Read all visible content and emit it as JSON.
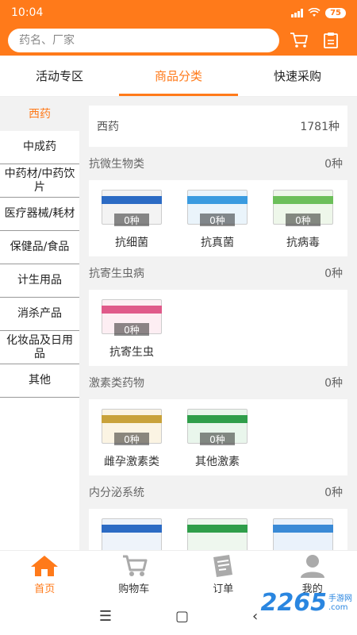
{
  "statusbar": {
    "time": "10:04",
    "battery": "75"
  },
  "search": {
    "placeholder": "药名、厂家"
  },
  "tabs": [
    {
      "label": "活动专区"
    },
    {
      "label": "商品分类"
    },
    {
      "label": "快速采购"
    }
  ],
  "sidebar": {
    "items": [
      {
        "label": "西药"
      },
      {
        "label": "中成药"
      },
      {
        "label": "中药材/中药饮片"
      },
      {
        "label": "医疗器械/耗材"
      },
      {
        "label": "保健品/食品"
      },
      {
        "label": "计生用品"
      },
      {
        "label": "消杀产品"
      },
      {
        "label": "化妆品及日用品"
      },
      {
        "label": "其他"
      }
    ]
  },
  "content": {
    "total": {
      "name": "西药",
      "count": "1781种"
    },
    "categories": [
      {
        "name": "抗微生物类",
        "count": "0种",
        "products": [
          {
            "name": "抗细菌",
            "count": "0种",
            "color": "#2c6bc4"
          },
          {
            "name": "抗真菌",
            "count": "0种",
            "color": "#3a9be0"
          },
          {
            "name": "抗病毒",
            "count": "0种",
            "color": "#6cbf5a"
          }
        ]
      },
      {
        "name": "抗寄生虫病",
        "count": "0种",
        "products": [
          {
            "name": "抗寄生虫",
            "count": "0种",
            "color": "#e05a8a"
          }
        ]
      },
      {
        "name": "激素类药物",
        "count": "0种",
        "products": [
          {
            "name": "雌孕激素类",
            "count": "0种",
            "color": "#c9a23a"
          },
          {
            "name": "其他激素",
            "count": "0种",
            "color": "#2f9e4a"
          }
        ]
      },
      {
        "name": "内分泌系统",
        "count": "0种",
        "products": []
      }
    ]
  },
  "bottom_nav": [
    {
      "label": "首页"
    },
    {
      "label": "购物车"
    },
    {
      "label": "订单"
    },
    {
      "label": "我的"
    }
  ],
  "watermark": {
    "brand": "2265",
    "sub1": "手游网",
    "sub2": ".com"
  },
  "colors": {
    "accent": "#ff7a1a"
  }
}
